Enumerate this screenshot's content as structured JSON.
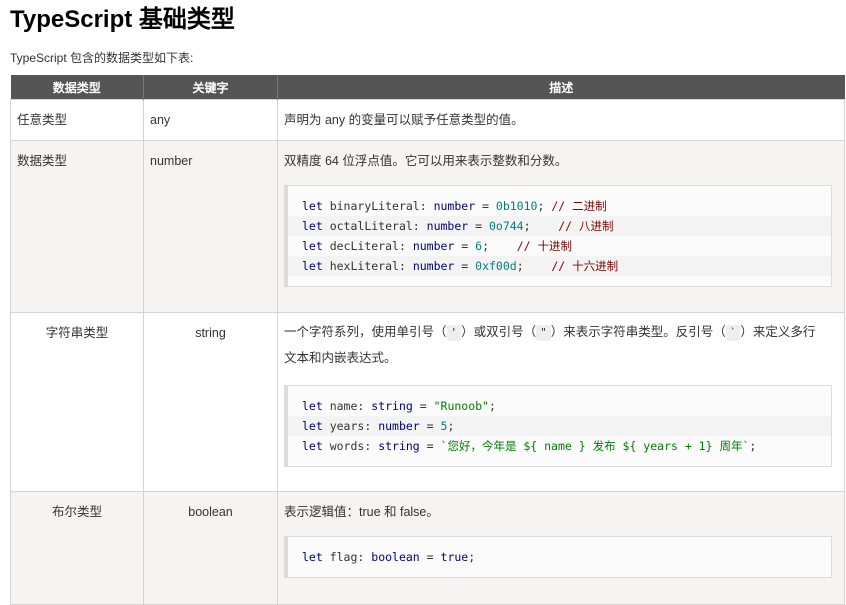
{
  "page": {
    "title": "TypeScript 基础类型",
    "intro": "TypeScript 包含的数据类型如下表:"
  },
  "table": {
    "headers": [
      "数据类型",
      "关键字",
      "描述"
    ],
    "rows": [
      {
        "type": "任意类型",
        "keyword": "any",
        "desc": "声明为 any 的变量可以赋予任意类型的值。"
      },
      {
        "type": "数据类型",
        "keyword": "number",
        "desc": "双精度 64 位浮点值。它可以用来表示整数和分数。"
      },
      {
        "type": "字符串类型",
        "keyword": "string",
        "desc_parts": [
          "一个字符系列，使用单引号（",
          "'",
          "）或双引号（",
          "\"",
          "）来表示字符串类型。反引号（",
          "`",
          "）来定义多行",
          "文本和内嵌表达式。"
        ]
      },
      {
        "type": "布尔类型",
        "keyword": "boolean",
        "desc": "表示逻辑值：true 和 false。"
      }
    ]
  },
  "code": {
    "number": [
      {
        "kw": "let",
        "name": " binaryLiteral",
        "sep": ": ",
        "ty": "number",
        "eq": " = ",
        "val": "0b1010",
        "end": "; ",
        "cm": "// 二进制"
      },
      {
        "kw": "let",
        "name": " octalLiteral",
        "sep": ": ",
        "ty": "number",
        "eq": " = ",
        "val": "0o744",
        "end": ";    ",
        "cm": "// 八进制"
      },
      {
        "kw": "let",
        "name": " decLiteral",
        "sep": ": ",
        "ty": "number",
        "eq": " = ",
        "val": "6",
        "end": ";    ",
        "cm": "// 十进制"
      },
      {
        "kw": "let",
        "name": " hexLiteral",
        "sep": ": ",
        "ty": "number",
        "eq": " = ",
        "val": "0xf00d",
        "end": ";    ",
        "cm": "// 十六进制"
      }
    ],
    "string": [
      {
        "kw": "let",
        "name": " name",
        "sep": ": ",
        "ty": "string",
        "eq": " = ",
        "str": "\"Runoob\"",
        "end": ";"
      },
      {
        "kw": "let",
        "name": " years",
        "sep": ": ",
        "ty": "number",
        "eq": " = ",
        "val": "5",
        "end": ";"
      },
      {
        "kw": "let",
        "name": " words",
        "sep": ": ",
        "ty": "string",
        "eq": " = ",
        "str": "`您好，今年是 ${ name } 发布 ${ years + 1} 周年`",
        "end": ";"
      }
    ],
    "boolean": [
      {
        "kw": "let",
        "name": " flag",
        "sep": ": ",
        "ty": "boolean",
        "eq": " = ",
        "val2": "true",
        "end": ";"
      }
    ]
  },
  "colors": {
    "header_bg": "#555555",
    "alt_row": "#f5f4f0",
    "keyword": "#00007f",
    "number": "#007f7f",
    "string": "#007f00",
    "comment": "#800000"
  }
}
